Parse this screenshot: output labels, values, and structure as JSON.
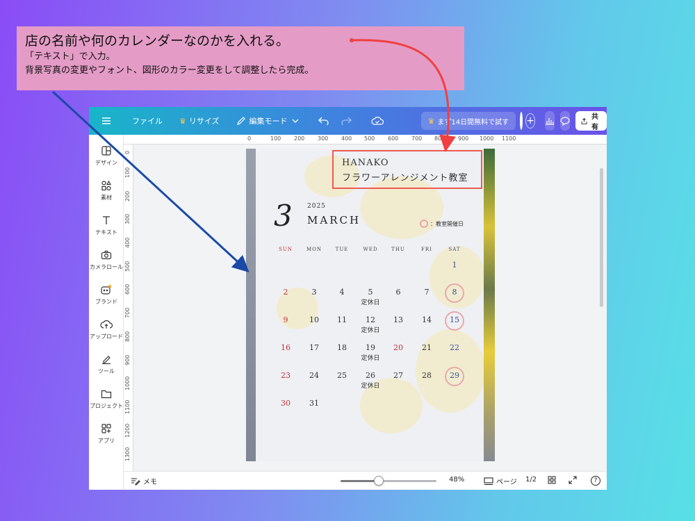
{
  "callout": {
    "title": "店の名前や何のカレンダーなのかを入れる。",
    "line1": "「テキスト」で入力。",
    "line2": "背景写真の変更やフォント、図形のカラー変更をして調整したら完成。"
  },
  "topbar": {
    "file": "ファイル",
    "resize": "リサイズ",
    "edit_mode": "編集モード",
    "trial": "まず14日間無料で試す",
    "share": "共有"
  },
  "sidebar": {
    "items": [
      {
        "label": "デザイン",
        "icon": "design-icon"
      },
      {
        "label": "素材",
        "icon": "elements-icon"
      },
      {
        "label": "テキスト",
        "icon": "text-icon"
      },
      {
        "label": "カメラロール",
        "icon": "camera-icon"
      },
      {
        "label": "ブランド",
        "icon": "brand-icon"
      },
      {
        "label": "アップロード",
        "icon": "upload-icon"
      },
      {
        "label": "ツール",
        "icon": "tools-icon"
      },
      {
        "label": "プロジェクト",
        "icon": "folder-icon"
      },
      {
        "label": "アプリ",
        "icon": "apps-icon"
      }
    ]
  },
  "ruler": {
    "top": [
      "0",
      "100",
      "200",
      "300",
      "400",
      "500",
      "600",
      "700",
      "800",
      "900",
      "1000",
      "1100"
    ],
    "left": [
      "0",
      "100",
      "200",
      "300",
      "400",
      "500",
      "600",
      "700",
      "800",
      "900",
      "1000",
      "1100",
      "1200",
      "1300"
    ]
  },
  "bottombar": {
    "memo": "メモ",
    "zoom": "48%",
    "zoom_value": 0.4,
    "pages_label": "ページ",
    "page_count": "1/2",
    "help": "?"
  },
  "calendar": {
    "name": "HANAKO",
    "subtitle": "フラワーアレンジメント教室",
    "month_number": "3",
    "year": "2025",
    "month": "MARCH",
    "legend": "：教室開催日",
    "weekdays": [
      "SUN",
      "MON",
      "TUE",
      "WED",
      "THU",
      "FRI",
      "SAT"
    ],
    "weeks": [
      [
        "",
        "",
        "",
        "",
        "",
        "",
        "1"
      ],
      [
        "2",
        "3",
        "4",
        "5",
        "6",
        "7",
        "8"
      ],
      [
        "9",
        "10",
        "11",
        "12",
        "13",
        "14",
        "15"
      ],
      [
        "16",
        "17",
        "18",
        "19",
        "20",
        "21",
        "22"
      ],
      [
        "23",
        "24",
        "25",
        "26",
        "27",
        "28",
        "29"
      ],
      [
        "30",
        "31",
        "",
        "",
        "",
        "",
        ""
      ]
    ],
    "closed_label": "定休日",
    "closed_days": [
      "5",
      "12",
      "19",
      "26"
    ],
    "class_days": [
      "8",
      "15",
      "29"
    ],
    "holidays": [
      "20"
    ],
    "colors": {
      "sunday": "#c0313a",
      "saturday": "#3a4ea0",
      "ring": "#e9a9a9"
    }
  },
  "colors": {
    "arrow_red": "#f04040",
    "arrow_blue": "#1a4aa8",
    "callout_bg": "#e49cc6"
  }
}
